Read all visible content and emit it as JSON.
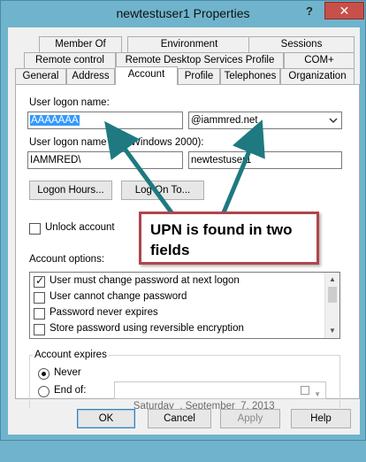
{
  "window": {
    "title": "newtestuser1 Properties",
    "help_glyph": "?",
    "close_glyph": "✕"
  },
  "tabs": {
    "row1": [
      {
        "label": "Member Of"
      },
      {
        "label": "Environment"
      },
      {
        "label": "Sessions"
      }
    ],
    "row2": [
      {
        "label": "Remote control"
      },
      {
        "label": "Remote Desktop Services Profile"
      },
      {
        "label": "COM+"
      }
    ],
    "row3": [
      {
        "label": "General"
      },
      {
        "label": "Address"
      },
      {
        "label": "Account"
      },
      {
        "label": "Profile"
      },
      {
        "label": "Telephones"
      },
      {
        "label": "Organization"
      }
    ],
    "active": "Account"
  },
  "account": {
    "logon_name_label": "User logon name:",
    "logon_name_value": "AAAAAAA",
    "upn_suffix_value": "@iammred.net",
    "pre2000_label": "User logon name (pre-Windows 2000):",
    "pre2000_domain": "IAMMRED\\",
    "pre2000_user": "newtestuser1",
    "logon_hours_button": "Logon Hours...",
    "log_on_to_button": "Log On To...",
    "unlock_label": "Unlock account",
    "unlock_checked": false,
    "account_options_label": "Account options:",
    "options": [
      {
        "label": "User must change password at next logon",
        "checked": true
      },
      {
        "label": "User cannot change password",
        "checked": false
      },
      {
        "label": "Password never expires",
        "checked": false
      },
      {
        "label": "Store password using reversible encryption",
        "checked": false
      }
    ],
    "expires_label": "Account expires",
    "never_label": "Never",
    "end_of_label": "End of:",
    "selected_expiry": "Never",
    "end_date": "Saturday  , September  7, 2013"
  },
  "callout": {
    "text": "UPN is found in two fields",
    "border_color": "#b1454b",
    "arrow_color": "#1e7a80"
  },
  "buttons": {
    "ok": "OK",
    "cancel": "Cancel",
    "apply": "Apply",
    "help": "Help"
  },
  "colors": {
    "frame": "#6fb4cc",
    "close": "#c7504a",
    "selection": "#3399ff"
  }
}
